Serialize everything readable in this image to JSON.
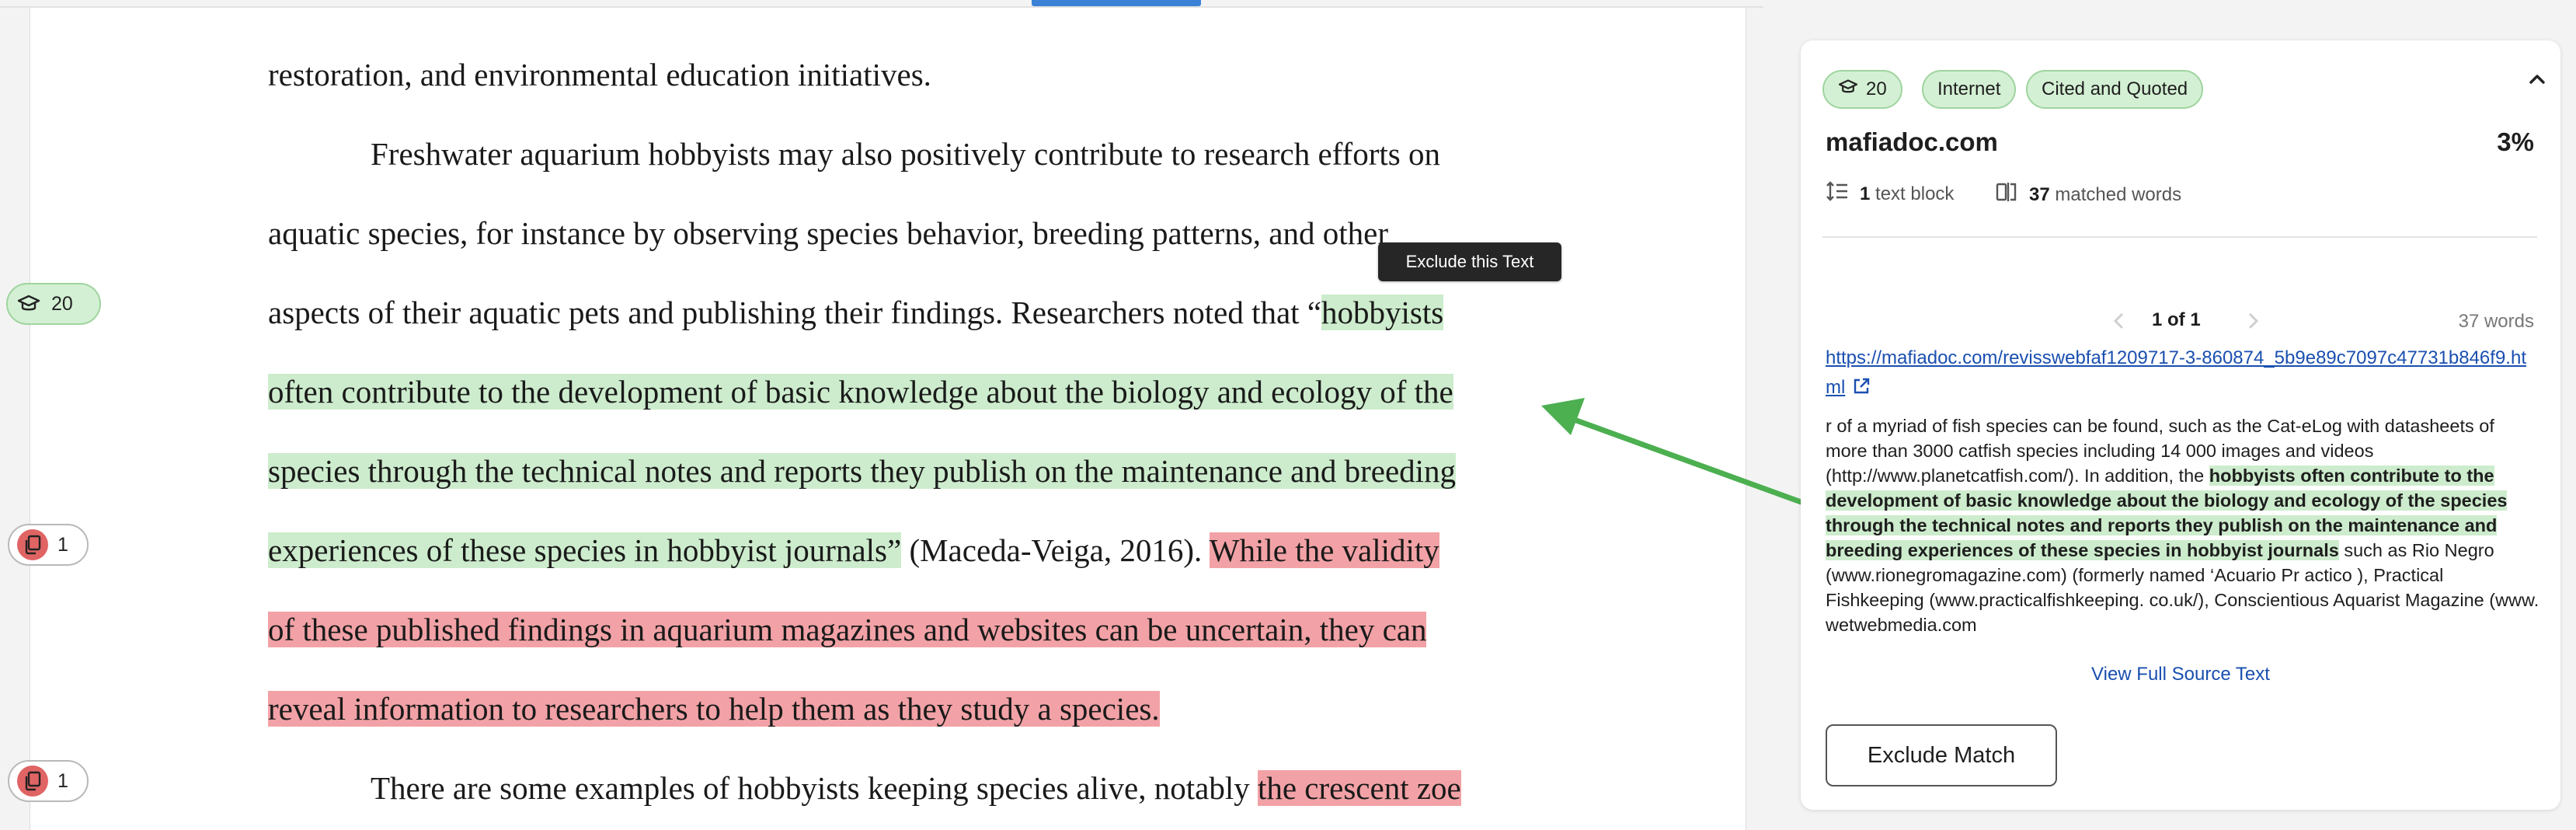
{
  "document": {
    "lines": [
      {
        "segments": [
          {
            "t": "restoration, and environmental education initiatives.",
            "hl": ""
          }
        ]
      },
      {
        "segments": [
          {
            "t": "Freshwater aquarium hobbyists may also positively contribute to research efforts on",
            "hl": ""
          }
        ]
      },
      {
        "segments": [
          {
            "t": "aquatic species, for instance by observing species behavior, breeding patterns, and other",
            "hl": ""
          }
        ]
      },
      {
        "segments": [
          {
            "t": "aspects of their aquatic pets and publishing their findings. Researchers noted that “",
            "hl": ""
          },
          {
            "t": "hobbyists",
            "hl": "green"
          }
        ]
      },
      {
        "segments": [
          {
            "t": "often contribute to the development of basic knowledge about the biology and ecology of the",
            "hl": "green"
          }
        ]
      },
      {
        "segments": [
          {
            "t": "species through the technical notes and reports they publish on the maintenance and breeding",
            "hl": "green"
          }
        ]
      },
      {
        "segments": [
          {
            "t": "experiences of these species in hobbyist journals”",
            "hl": "green"
          },
          {
            "t": " (Maceda-Veiga, 2016). ",
            "hl": ""
          },
          {
            "t": "While the validity",
            "hl": "red"
          }
        ]
      },
      {
        "segments": [
          {
            "t": "of these published findings in aquarium magazines and websites can be uncertain, they can",
            "hl": "red"
          }
        ]
      },
      {
        "segments": [
          {
            "t": "reveal information to researchers to help them as they study a species.",
            "hl": "red"
          }
        ]
      },
      {
        "segments": [
          {
            "t": "There are some examples of hobbyists keeping species alive, notably ",
            "hl": ""
          },
          {
            "t": "the crescent zoe",
            "hl": "red"
          }
        ]
      }
    ],
    "tooltip": "Exclude this Text"
  },
  "margin_badges": {
    "green_count": "20",
    "red_count_1": "1",
    "red_count_2": "1"
  },
  "panel": {
    "pills": {
      "count": "20",
      "internet": "Internet",
      "cited": "Cited and Quoted"
    },
    "source_name": "mafiadoc.com",
    "percent": "3%",
    "text_blocks_count": "1",
    "text_blocks_label": "text block",
    "matched_count": "37",
    "matched_label": "matched words",
    "pager": "1 of 1",
    "words": "37 words",
    "url": "https://mafiadoc.com/revisswebfaf1209717-3-860874_5b9e89c7097c47731b846f9.html",
    "source_text": {
      "pre": "r of a myriad of fish species can be found, such as the Cat-eLog with datasheets of more than 3000 catfish species including 14 000 images and videos (http://www.planetcatfish.com/). In addition, the ",
      "match": "hobbyists often contribute to the development of basic knowledge about the biology and ecology of the species through the technical notes and reports they publish on the maintenance and breeding experiences of these species in hobbyist journals",
      "post": " such as Rio Negro (www.rionegromagazine.com) (formerly named ‘Acuario Pr  actico ), Practical Fishkeeping (www.practicalfishkeeping. co.uk/), Conscientious Aquarist Magazine (www. wetwebmedia.com"
    },
    "view_full": "View Full Source Text",
    "exclude_button": "Exclude Match"
  },
  "colors": {
    "green_highlight": "#cdeccd",
    "red_highlight": "#f2a2a6",
    "arrow": "#4caf50",
    "link": "#1a4fb0"
  }
}
